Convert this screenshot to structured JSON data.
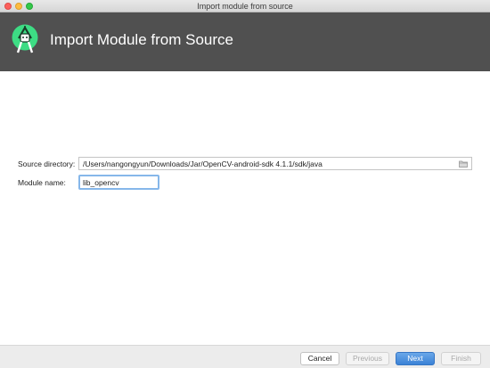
{
  "window": {
    "title": "Import module from source"
  },
  "header": {
    "title": "Import Module from Source"
  },
  "form": {
    "source_directory_label": "Source directory:",
    "source_directory_value": "/Users/nangongyun/Downloads/Jar/OpenCV-android-sdk 4.1.1/sdk/java",
    "module_name_label": "Module name:",
    "module_name_value": "lib_opencv"
  },
  "footer": {
    "cancel_label": "Cancel",
    "previous_label": "Previous",
    "next_label": "Next",
    "finish_label": "Finish"
  },
  "icons": {
    "app_logo": "android-studio-icon",
    "folder": "folder-icon"
  },
  "colors": {
    "header_bg": "#505050",
    "accent": "#3b82d6",
    "logo_green": "#3ddc84"
  }
}
